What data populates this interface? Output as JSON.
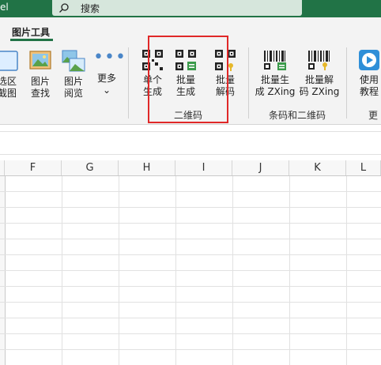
{
  "titlebar": {
    "app_name_fragment": "el",
    "search_placeholder": "搜索"
  },
  "ribbon": {
    "active_tab": "图片工具",
    "buttons": {
      "screenshot": "选区\n截图",
      "image_search": "图片\n查找",
      "image_browse": "图片\n阅览",
      "more": "更多",
      "single_generate": "单个\n生成",
      "batch_generate": "批量\n生成",
      "batch_decode": "批量\n解码",
      "batch_gen_zxing": "批量生\n成 ZXing",
      "batch_decode_zxing": "批量解\n码 ZXing",
      "tutorial": "使用\n教程"
    },
    "groups": {
      "qrcode": "二维码",
      "barcode_qrcode": "条码和二维码",
      "partial": "更"
    },
    "more_chevron": "⌄"
  },
  "sheet": {
    "columns": [
      "F",
      "G",
      "H",
      "I",
      "J",
      "K",
      "L"
    ]
  },
  "colors": {
    "accent": "#217346",
    "highlight_box": "#e02828"
  },
  "icons": {
    "search": "search-icon",
    "screenshot": "screenshot-icon",
    "image_search": "image-search-icon",
    "image_browse": "image-browse-icon",
    "more": "more-dots-icon",
    "qrcode": "qrcode-icon",
    "barcode": "barcode-icon",
    "play": "play-icon"
  }
}
